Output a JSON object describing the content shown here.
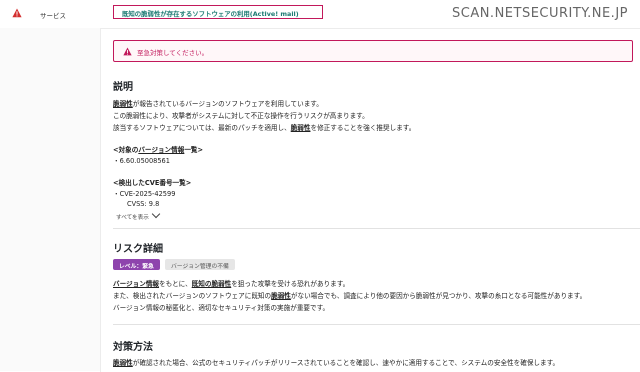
{
  "nav": {
    "service_label": "サービス"
  },
  "header": {
    "title_link": "既知の脆弱性が存在するソフトウェアの利用(Active! mail)",
    "watermark": "SCAN.NETSECURITY.NE.JP"
  },
  "alert": {
    "text": "至急対策してください。",
    "color": "#c2185b"
  },
  "description": {
    "heading": "説明",
    "line1_term": "脆弱性",
    "line1_rest": "が報告されているバージョンのソフトウェアを利用しています。",
    "line2": "この脆弱性により、攻撃者がシステムに対して不正な操作を行うリスクが高まります。",
    "line3_pre": "該当するソフトウェアについては、最新のパッチを適用し、",
    "line3_term": "脆弱性",
    "line3_post": "を修正することを強く推奨します。",
    "versions_heading_pre": "<対象の",
    "versions_heading_term": "バージョン情報",
    "versions_heading_post": "一覧>",
    "versions": [
      "・6.60.05008561"
    ],
    "cve_heading": "<検出したCVE番号一覧>",
    "cves": [
      "・CVE-2025-42599"
    ],
    "cvss": "CVSS: 9.8",
    "show_all": "すべてを表示"
  },
  "risk": {
    "heading": "リスク詳細",
    "badge_level": "レベル：緊急",
    "badge_category": "バージョン管理の不備",
    "badge_level_color": "#8e44ad",
    "line1_term1": "バージョン情報",
    "line1_mid": "をもとに、",
    "line1_term2": "既知の脆弱性",
    "line1_post": "を狙った攻撃を受ける恐れがあります。",
    "line2_pre": "また、検出されたバージョンのソフトウェアに既知の",
    "line2_term": "脆弱性",
    "line2_post": "がない場合でも、調査により他の要因から脆弱性が見つかり、攻撃の糸口となる可能性があります。",
    "line3": "バージョン情報の秘匿化と、適切なセキュリティ対策の実施が重要です。"
  },
  "measures": {
    "heading": "対策方法",
    "line1_term": "脆弱性",
    "line1_rest": "が確認された場合、公式のセキュリティパッチがリリースされていることを確認し、速やかに適用することで、システムの安全性を確保します。"
  },
  "icons": {
    "warning": "warning-triangle-icon",
    "chevron": "chevron-down-icon"
  }
}
